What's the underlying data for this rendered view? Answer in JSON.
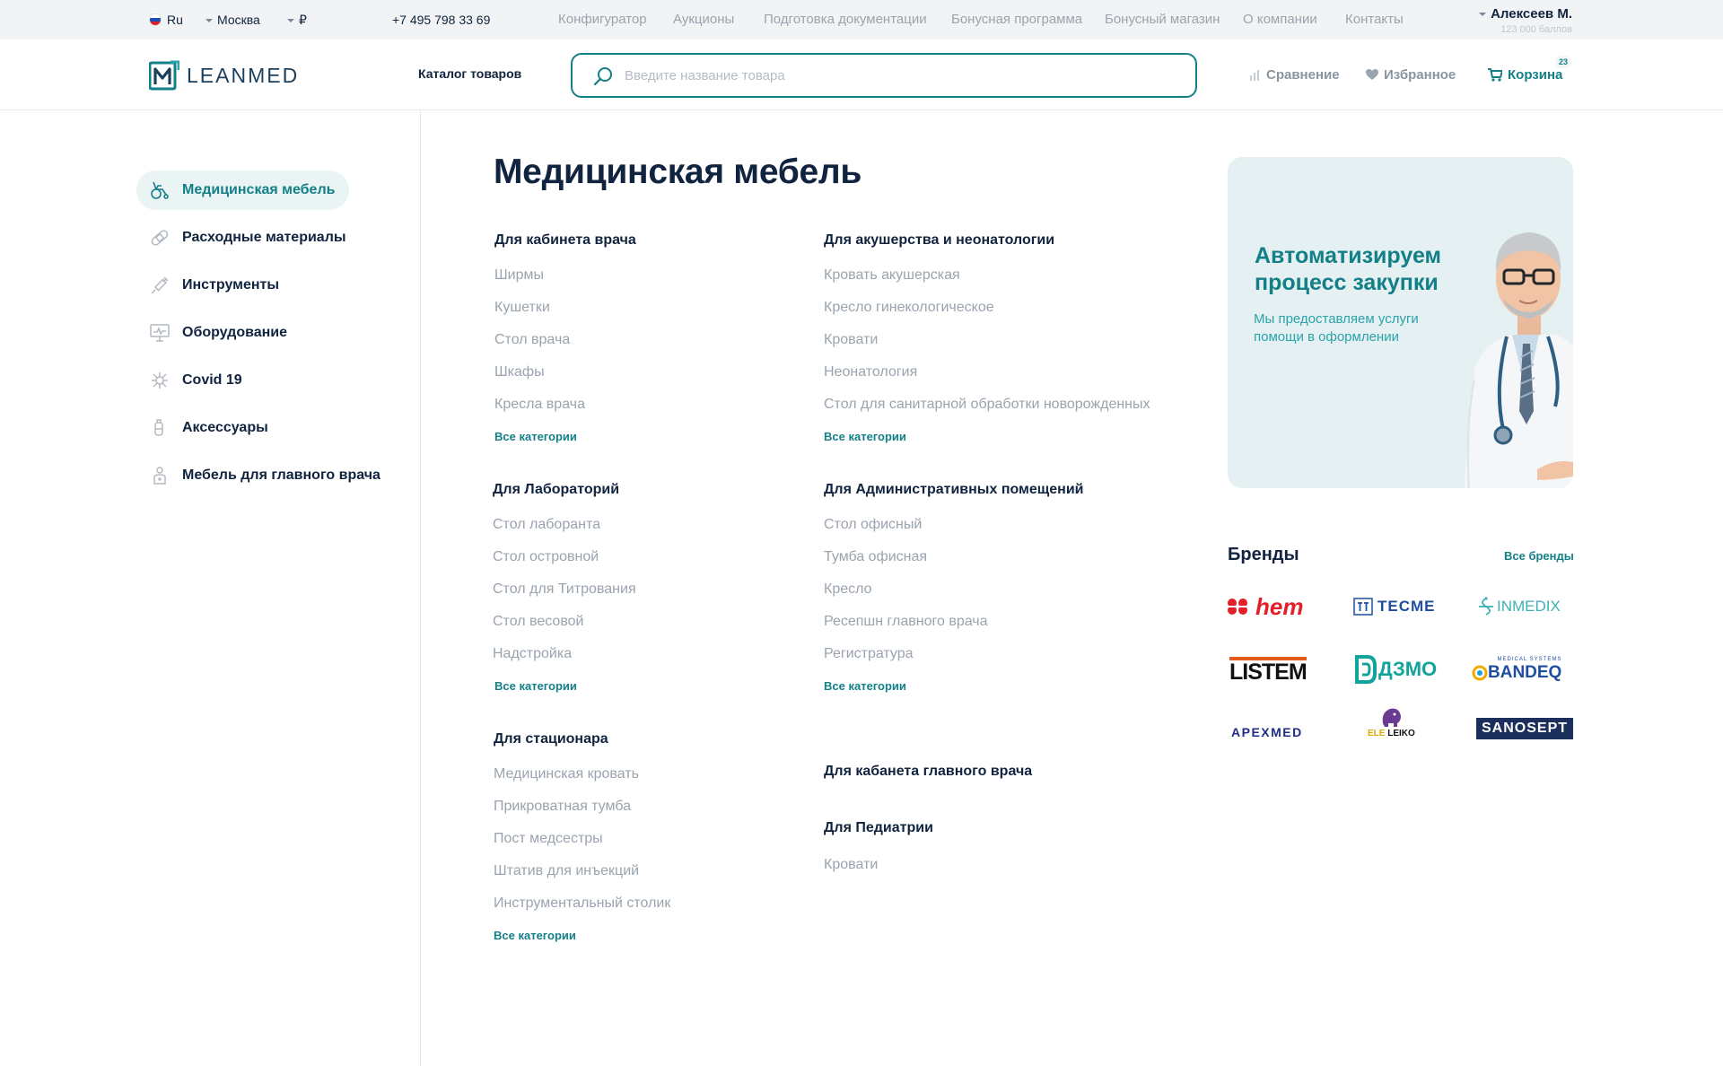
{
  "topbar": {
    "language": "Ru",
    "city": "Москва",
    "currency": "₽",
    "phone": "+7 495 798 33 69",
    "links": [
      "Конфигуратор",
      "Аукционы",
      "Подготовка документации",
      "Бонусная программа",
      "Бонусный магазин",
      "О компании",
      "Контакты"
    ],
    "user_name": "Алексеев М.",
    "user_points": "123 000 баллов"
  },
  "header": {
    "logo_text": "LEANMED",
    "catalog_label": "Каталог товаров",
    "search_placeholder": "Введите название товара",
    "compare_label": "Сравнение",
    "favorites_label": "Избранное",
    "cart_label": "Корзина",
    "cart_count": "23"
  },
  "sidebar": {
    "items": [
      {
        "label": "Медицинская мебель",
        "icon": "wheelchair-icon"
      },
      {
        "label": "Расходные материалы",
        "icon": "bandage-icon"
      },
      {
        "label": "Инструменты",
        "icon": "syringe-icon"
      },
      {
        "label": "Оборудование",
        "icon": "monitor-icon"
      },
      {
        "label": "Covid 19",
        "icon": "virus-icon"
      },
      {
        "label": "Аксессуары",
        "icon": "accessory-icon"
      },
      {
        "label": "Мебель для главного врача",
        "icon": "chief-doctor-icon"
      }
    ]
  },
  "content": {
    "title": "Медицинская мебель",
    "all_categories_label": "Все категории",
    "groups": [
      {
        "title": "Для кабинета врача",
        "items": [
          "Ширмы",
          "Кушетки",
          "Стол врача",
          "Шкафы",
          "Кресла врача"
        ]
      },
      {
        "title": "Для акушерства и неонатологии",
        "items": [
          "Кровать акушерская",
          "Кресло гинекологическое",
          "Кровати",
          "Неонатология",
          "Стол для санитарной обработки новорожденных"
        ]
      },
      {
        "title": "Для Лабораторий",
        "items": [
          "Стол лаборанта",
          "Стол островной",
          "Стол для Титрования",
          "Стол весовой",
          "Надстройка"
        ]
      },
      {
        "title": "Для Административных помещений",
        "items": [
          "Стол офисный",
          "Тумба офисная",
          "Кресло",
          "Ресепшн главного врача",
          "Регистратура"
        ]
      },
      {
        "title": "Для стационара",
        "items": [
          "Медицинская кровать",
          "Прикроватная тумба",
          "Пост медсестры",
          "Штатив для инъекций",
          "Инструментальный столик"
        ]
      },
      {
        "title": "Для кабанета главного врача",
        "items": []
      },
      {
        "title": "Для Педиатрии",
        "items": [
          "Кровати"
        ]
      }
    ]
  },
  "banner": {
    "title": "Автоматизируем процесс закупки",
    "text": "Мы предоставляем услуги помощи в оформлении"
  },
  "brands": {
    "title": "Бренды",
    "all_label": "Все бренды",
    "logos": [
      {
        "name": "hem",
        "color": "#e3202a"
      },
      {
        "name": "TECME",
        "color": "#1f4ea1"
      },
      {
        "name": "INMEDIX",
        "color": "#3fb0b8"
      },
      {
        "name": "LISTEM",
        "color": "#111111"
      },
      {
        "name": "ДЗМО",
        "color": "#12a39a"
      },
      {
        "name": "MEDICAL SYSTEMS",
        "color": "#1f4ea1"
      },
      {
        "name": "BANDEQ",
        "color": "#1f4ea1"
      },
      {
        "name": "APEXMED",
        "color": "#1f2d8a"
      },
      {
        "name": "ELE",
        "color": "#e0a800"
      },
      {
        "name": "LEIKO",
        "color": "#111111"
      },
      {
        "name": "SANOSEPT",
        "color": "#1c2f5c"
      }
    ]
  },
  "colors": {
    "accent": "#137f87",
    "text": "#10233f",
    "muted": "#9aa3ae"
  }
}
